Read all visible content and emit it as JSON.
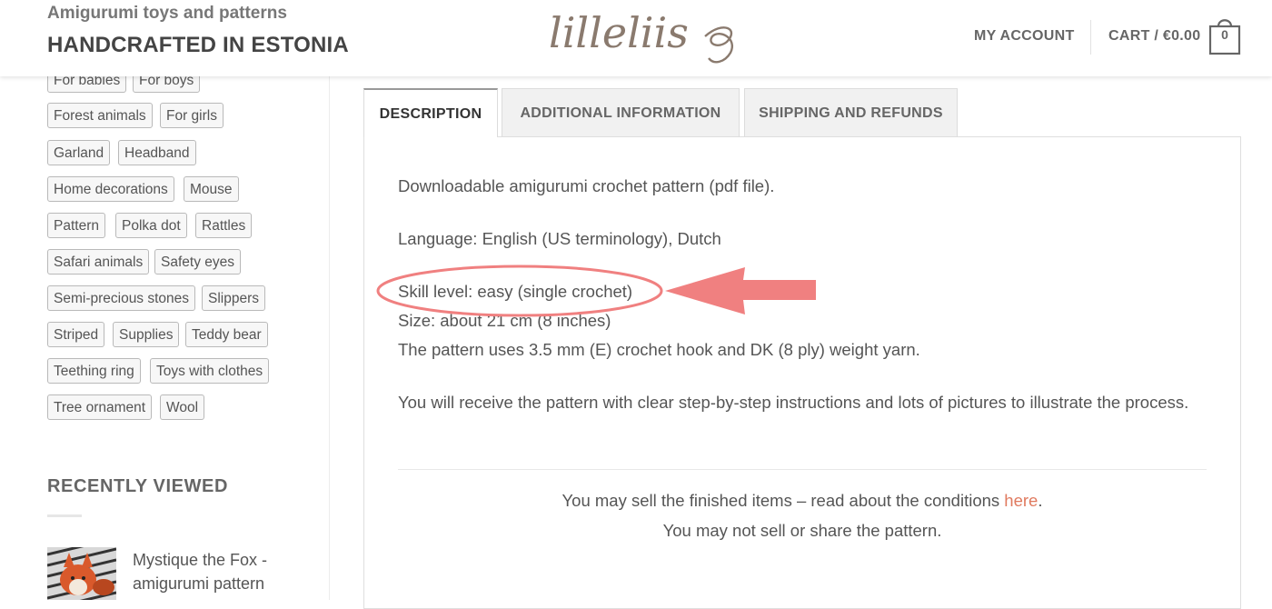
{
  "header": {
    "tagline": "Amigurumi toys and patterns",
    "site_title": "HANDCRAFTED IN ESTONIA",
    "logo_text": "lilleliis",
    "my_account": "MY ACCOUNT",
    "cart_label": "CART / €0.00",
    "cart_count": "0"
  },
  "sidebar": {
    "tags": [
      "For babies",
      "For boys",
      "Forest animals",
      "For girls",
      "Garland",
      "Headband",
      "Home decorations",
      "Mouse",
      "Pattern",
      "Polka dot",
      "Rattles",
      "Safari animals",
      "Safety eyes",
      "Semi-precious stones",
      "Slippers",
      "Striped",
      "Supplies",
      "Teddy bear",
      "Teething ring",
      "Toys with clothes",
      "Tree ornament",
      "Wool"
    ],
    "recently_viewed_title": "RECENTLY VIEWED",
    "recently_viewed_item": "Mystique the Fox - amigurumi pattern"
  },
  "tabs": {
    "description": "DESCRIPTION",
    "additional": "ADDITIONAL INFORMATION",
    "shipping": "SHIPPING AND REFUNDS"
  },
  "description": {
    "line1": "Downloadable amigurumi crochet pattern (pdf file).",
    "language": "Language: English (US terminology), Dutch",
    "skill": "Skill level: easy (single crochet)",
    "size": "Size: about 21 cm (8 inches)",
    "hook": "The pattern uses 3.5 mm (E) crochet hook and DK (8 ply) weight yarn.",
    "receive": "You will receive the pattern with clear step-by-step instructions and lots of pictures to illustrate the process.",
    "sell_prefix": "You may sell the finished items – read about the conditions ",
    "sell_link": "here",
    "sell_suffix": ".",
    "no_sell": "You may not sell or share the pattern."
  },
  "colors": {
    "annotation": "#f08080",
    "link": "#e07a5f",
    "logo": "#8a7a6e"
  }
}
